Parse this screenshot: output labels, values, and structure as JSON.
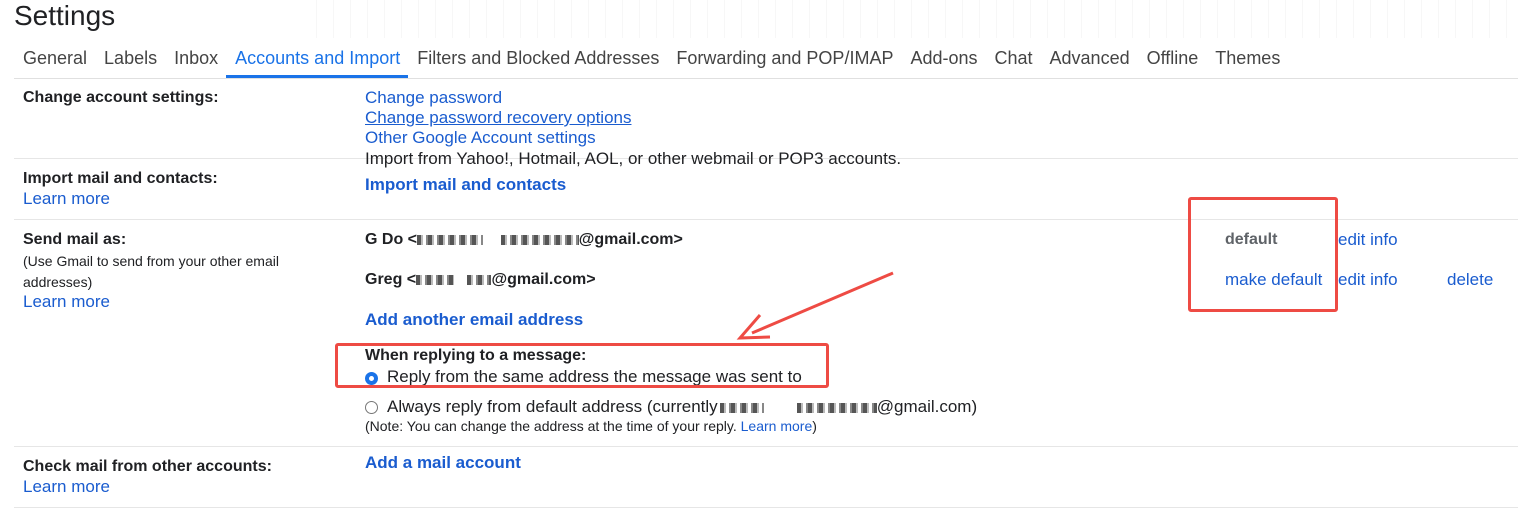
{
  "header": {
    "title": "Settings"
  },
  "tabs": [
    "General",
    "Labels",
    "Inbox",
    "Accounts and Import",
    "Filters and Blocked Addresses",
    "Forwarding and POP/IMAP",
    "Add-ons",
    "Chat",
    "Advanced",
    "Offline",
    "Themes"
  ],
  "change_account": {
    "label": "Change account settings:",
    "links": [
      "Change password",
      "Change password recovery options",
      "Other Google Account settings"
    ]
  },
  "import_mail": {
    "label": "Import mail and contacts:",
    "learn_more": "Learn more",
    "description": "Import from Yahoo!, Hotmail, AOL, or other webmail or POP3 accounts.",
    "action": "Import mail and contacts"
  },
  "send_mail": {
    "label": "Send mail as:",
    "sub": "(Use Gmail to send from your other email addresses)",
    "learn_more": "Learn more",
    "accounts": [
      {
        "name_prefix": "G Do <",
        "suffix": "@gmail.com>",
        "status": "default",
        "edit": "edit info"
      },
      {
        "name_prefix": "Greg <",
        "suffix": "@gmail.com>",
        "action": "make default",
        "edit": "edit info",
        "delete": "delete"
      }
    ],
    "add_address": "Add another email address",
    "reply_heading": "When replying to a message:",
    "reply_option_same": "Reply from the same address the message was sent to",
    "reply_option_default_prefix": "Always reply from default address (currently",
    "reply_option_default_suffix": "@gmail.com)",
    "reply_selected": "same",
    "note_text": "(Note: You can change the address at the time of your reply.",
    "note_link": "Learn more",
    "note_end": ")"
  },
  "check_mail": {
    "label": "Check mail from other accounts:",
    "learn_more": "Learn more",
    "action": "Add a mail account"
  },
  "colors": {
    "link": "#1a5ccf",
    "active_tab": "#1a73e8",
    "annotation": "#ee4b44"
  }
}
